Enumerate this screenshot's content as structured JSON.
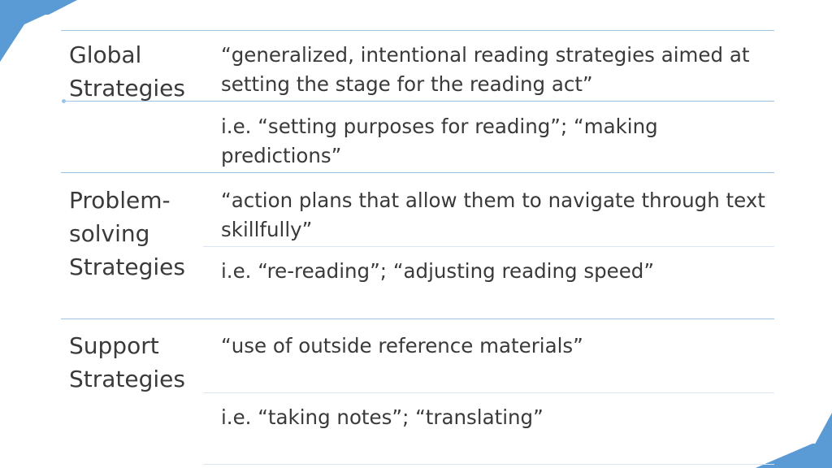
{
  "rows": [
    {
      "category": "Global\nStrategies",
      "definition": "“generalized, intentional reading strategies aimed at setting the stage for the reading act”",
      "example": "i.e. “setting purposes for reading”; “making predictions”"
    },
    {
      "category": "Problem-\nsolving\nStrategies",
      "definition": "“action plans that allow them to navigate through text skillfully”",
      "example": "i.e. “re-reading”;  “adjusting reading speed”"
    },
    {
      "category": "Support\nStrategies",
      "definition": "“use of outside reference materials”",
      "example": "i.e. “taking notes”; “translating”"
    }
  ],
  "colors": {
    "accent": "#5b9bd5",
    "rule": "#9dc3e6",
    "text": "#3a3a3a"
  }
}
